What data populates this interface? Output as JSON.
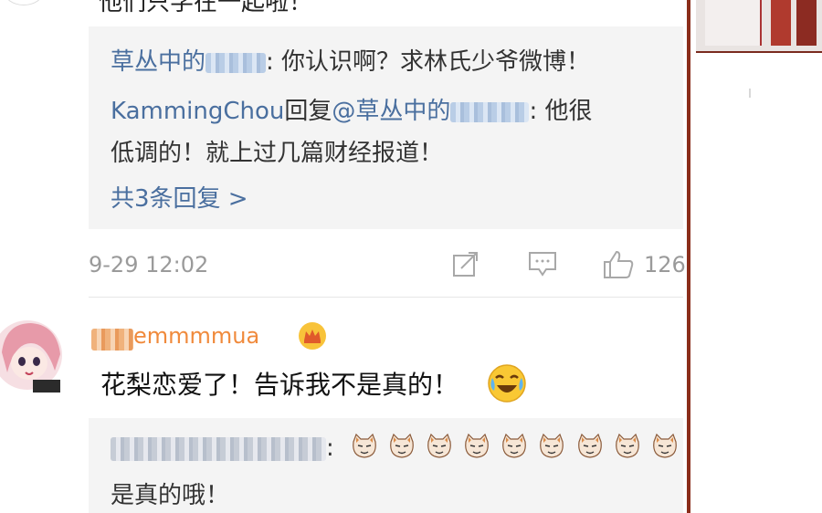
{
  "thread": {
    "top_clipped_text": "他们只学在一起啦！",
    "first_comment": {
      "replies": [
        {
          "author": "草丛中的",
          "author_censored": true,
          "text": ": 你认识啊？求林氏少爷微博！"
        },
        {
          "author": "KammingChou",
          "reply_word": "回复",
          "mention": "@草丛中的",
          "text_line1": ": 他很",
          "text_line2": "低调的！就上过几篇财经报道！"
        }
      ],
      "more_replies": "共3条回复 >",
      "timestamp": "9-29 12:02",
      "like_count": "126",
      "icons": [
        "share-icon",
        "comment-icon",
        "like-icon"
      ]
    },
    "second_comment": {
      "username": "emmmmua",
      "username_censored": true,
      "badge": "crown-icon",
      "text": "花梨恋爱了！告诉我不是真的！",
      "emoji": "laugh-cry-emoji",
      "reply": {
        "author_censored": true,
        "separator": ":",
        "emoji_sequence": [
          "cat-emoji",
          "cat-emoji",
          "cat-emoji",
          "cat-emoji",
          "cat-emoji",
          "cat-emoji",
          "cat-emoji",
          "cat-emoji",
          "cat-emoji"
        ],
        "text": "是真的哦！"
      }
    }
  },
  "colors": {
    "link": "#4a6f9f",
    "meta_grey": "#9a9a9a",
    "panel_bg": "#f4f4f4",
    "divider": "#8a2d1a"
  }
}
